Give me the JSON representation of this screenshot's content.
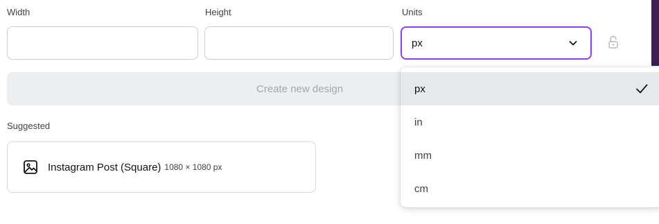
{
  "form": {
    "width_label": "Width",
    "height_label": "Height",
    "units_label": "Units",
    "width_value": "",
    "height_value": "",
    "units_value": "px"
  },
  "create_button": {
    "label": "Create new design"
  },
  "suggested": {
    "label": "Suggested",
    "item": {
      "name": "Instagram Post (Square)",
      "dims": "1080 × 1080 px",
      "icon": "image-icon"
    }
  },
  "dropdown": {
    "options": [
      {
        "label": "px",
        "selected": true
      },
      {
        "label": "in",
        "selected": false
      },
      {
        "label": "mm",
        "selected": false
      },
      {
        "label": "cm",
        "selected": false
      }
    ]
  },
  "colors": {
    "accent": "#8b3dff",
    "button_bg": "#eceef0",
    "selected_option_bg": "#e6e8eb",
    "edge": "#3a1f54"
  }
}
